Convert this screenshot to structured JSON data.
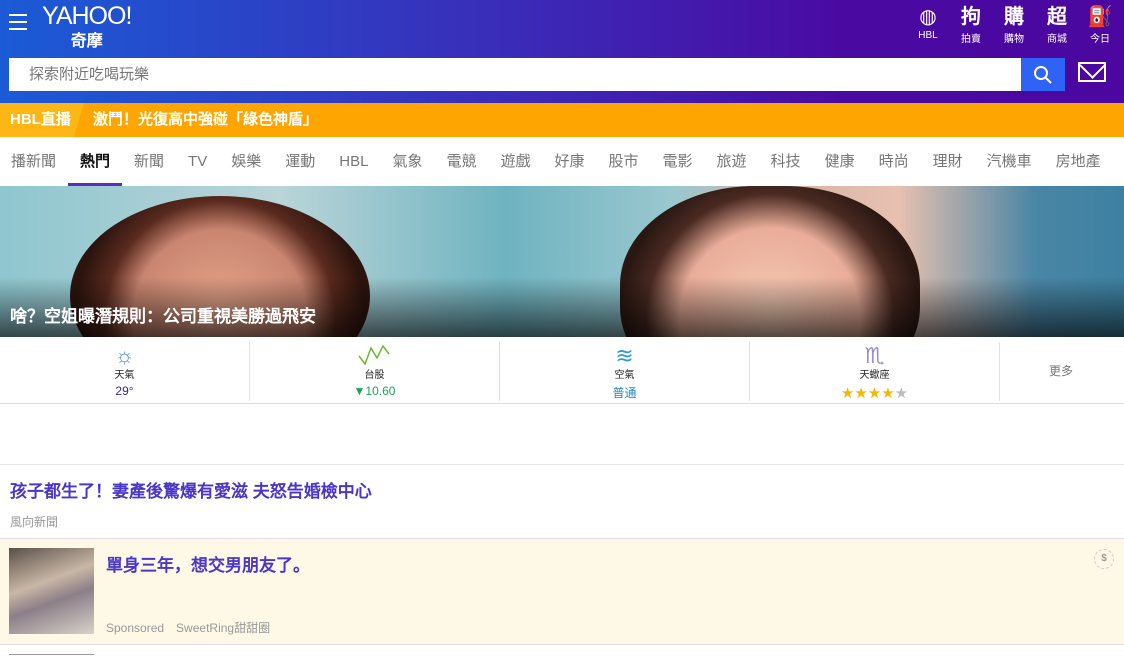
{
  "header": {
    "logo_text": "YAHOO!",
    "logo_sub": "奇摩",
    "shortcuts": [
      {
        "icon": "basketball-icon",
        "label": "HBL"
      },
      {
        "icon": "auction-icon",
        "label": "拍賣"
      },
      {
        "icon": "shopping-icon",
        "label": "購物"
      },
      {
        "icon": "mall-icon",
        "label": "商城"
      },
      {
        "icon": "today-icon",
        "label": "今日"
      }
    ],
    "search_placeholder": "探索附近吃喝玩樂"
  },
  "ticker": {
    "tag": "HBL直播",
    "headline": "激鬥！光復高中強碰「綠色神盾」"
  },
  "nav": {
    "tabs": [
      "播新聞",
      "熱門",
      "新聞",
      "TV",
      "娛樂",
      "運動",
      "HBL",
      "氣象",
      "電競",
      "遊戲",
      "好康",
      "股市",
      "電影",
      "旅遊",
      "科技",
      "健康",
      "時尚",
      "理財",
      "汽機車",
      "房地產"
    ],
    "active": "熱門"
  },
  "hero": {
    "caption": "啥？空姐曝潛規則：公司重視美勝過飛安"
  },
  "widgets": [
    {
      "title": "天氣",
      "value": "29°",
      "color": "#3a1f96"
    },
    {
      "title": "台股",
      "value": "▼10.60",
      "color": "#1aa55a"
    },
    {
      "title": "空氣",
      "value": "普通",
      "color": "#1e88c8"
    },
    {
      "title": "天蠍座",
      "value": "★★★★",
      "rating": 4,
      "max": 5,
      "color": "#f5b800"
    }
  ],
  "widgets_more": "更多",
  "article": {
    "title": "孩子都生了！妻產後驚爆有愛滋 夫怒告婚檢中心",
    "source": "風向新聞"
  },
  "sponsored": {
    "title": "單身三年，想交男朋友了。",
    "label": "Sponsored",
    "advertiser": "SweetRing甜甜圈",
    "badge": "$"
  }
}
